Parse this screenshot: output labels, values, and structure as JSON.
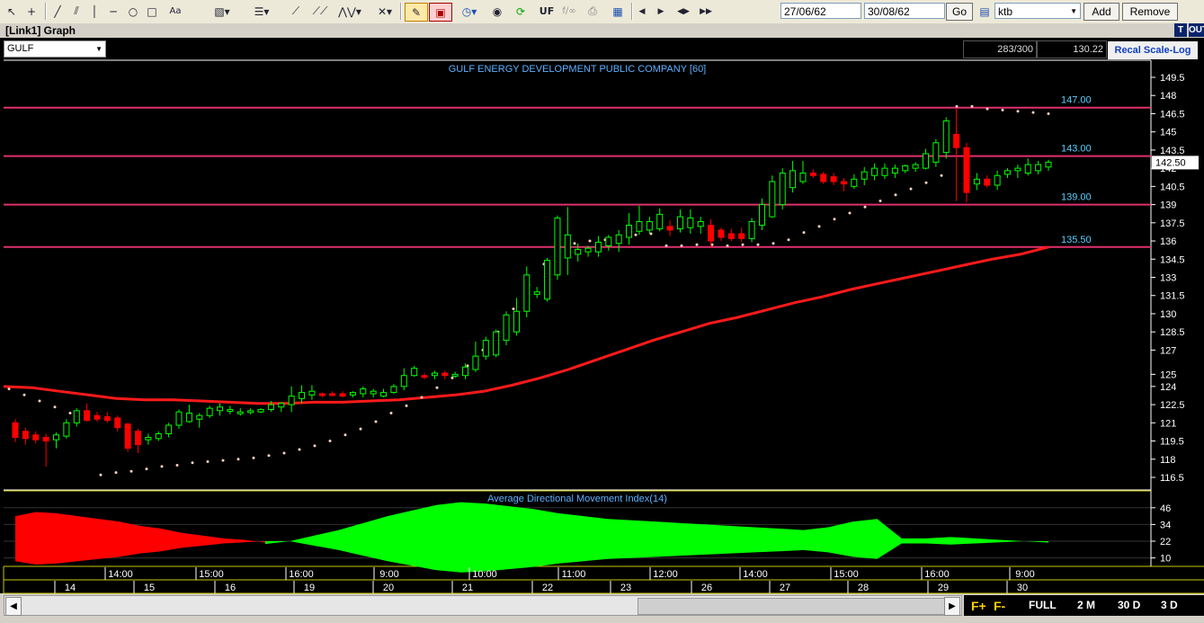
{
  "toolbar": {
    "icons": [
      "pointer-icon",
      "crosshair-icon",
      "line-icon",
      "parallel-lines-icon",
      "vertical-line-icon",
      "horizontal-line-icon",
      "circle-icon",
      "rectangle-icon",
      "text-icon",
      "fibonacci-icon",
      "horizontal-lines-icon",
      "channel-icon",
      "zigzag-icon",
      "delete-icon",
      "pencil-icon",
      "eraser-icon",
      "clock-icon",
      "palette-icon",
      "refresh-icon",
      "uf-icon",
      "fo-icon",
      "print-icon",
      "chart-icon",
      "left-icon",
      "right-icon",
      "expand-icon",
      "fast-forward-icon"
    ],
    "uf_label": "UF",
    "fo_label": "f∕∞",
    "date_from": "27/06/62",
    "date_to": "30/08/62",
    "go_label": "Go",
    "symbol_input": "ktb",
    "add_label": "Add",
    "remove_label": "Remove"
  },
  "window": {
    "title": "[Link1] Graph",
    "t_label": "T",
    "out_label": "OUT"
  },
  "symbol_select": "GULF",
  "info": {
    "count": "283/300",
    "last": "130.22",
    "recal": "Recal Scale-Log"
  },
  "colors": {
    "up": "#00ff00",
    "down": "#ff0000",
    "line": "#ff1a1a",
    "hline": "#e0306e",
    "text": "#5ab0ff",
    "axis": "#ffffff"
  },
  "chart_data": {
    "type": "candlestick",
    "title": "GULF ENERGY DEVELOPMENT PUBLIC COMPANY [60]",
    "price_ticks": [
      "116.5",
      "118",
      "119.5",
      "121",
      "122.5",
      "124",
      "125",
      "127",
      "128.5",
      "130",
      "131.5",
      "133",
      "134.5",
      "136",
      "137.5",
      "139",
      "140.5",
      "142",
      "143.5",
      "145",
      "146.5",
      "148",
      "149.5"
    ],
    "last_price": "142.50",
    "hlines": [
      {
        "value": 147.0,
        "label": "147.00"
      },
      {
        "value": 143.0,
        "label": "143.00"
      },
      {
        "value": 139.0,
        "label": "139.00"
      },
      {
        "value": 135.5,
        "label": "135.50"
      }
    ],
    "candles": [
      {
        "o": 121,
        "h": 121.3,
        "l": 119.4,
        "c": 119.8
      },
      {
        "o": 120.3,
        "h": 120.6,
        "l": 119.2,
        "c": 119.7
      },
      {
        "o": 120.0,
        "h": 120.3,
        "l": 119.3,
        "c": 119.6
      },
      {
        "o": 119.8,
        "h": 120.1,
        "l": 117.4,
        "c": 119.5
      },
      {
        "o": 119.6,
        "h": 120.2,
        "l": 118.9,
        "c": 120.0
      },
      {
        "o": 119.9,
        "h": 121.3,
        "l": 119.7,
        "c": 121.0
      },
      {
        "o": 121.0,
        "h": 122.2,
        "l": 120.7,
        "c": 122.0
      },
      {
        "o": 122.0,
        "h": 122.6,
        "l": 121.1,
        "c": 121.2
      },
      {
        "o": 121.6,
        "h": 121.9,
        "l": 121.1,
        "c": 121.3
      },
      {
        "o": 121.5,
        "h": 121.9,
        "l": 121.0,
        "c": 121.2
      },
      {
        "o": 121.4,
        "h": 121.6,
        "l": 120.3,
        "c": 120.6
      },
      {
        "o": 120.9,
        "h": 121.0,
        "l": 118.6,
        "c": 118.9
      },
      {
        "o": 120.3,
        "h": 120.5,
        "l": 118.5,
        "c": 119.2
      },
      {
        "o": 119.6,
        "h": 120.1,
        "l": 119.2,
        "c": 119.8
      },
      {
        "o": 119.7,
        "h": 120.3,
        "l": 119.5,
        "c": 120.1
      },
      {
        "o": 120.1,
        "h": 121.0,
        "l": 119.8,
        "c": 120.8
      },
      {
        "o": 120.8,
        "h": 122.1,
        "l": 120.5,
        "c": 121.9
      },
      {
        "o": 121.1,
        "h": 122.5,
        "l": 121.0,
        "c": 121.8
      },
      {
        "o": 121.3,
        "h": 121.8,
        "l": 120.6,
        "c": 121.6
      },
      {
        "o": 121.6,
        "h": 122.4,
        "l": 121.4,
        "c": 122.2
      },
      {
        "o": 122.0,
        "h": 122.6,
        "l": 121.6,
        "c": 122.3
      },
      {
        "o": 122.0,
        "h": 122.4,
        "l": 121.7,
        "c": 122.1
      },
      {
        "o": 121.8,
        "h": 122.2,
        "l": 121.6,
        "c": 121.9
      },
      {
        "o": 121.9,
        "h": 122.2,
        "l": 121.7,
        "c": 122.0
      },
      {
        "o": 121.9,
        "h": 122.2,
        "l": 121.8,
        "c": 122.1
      },
      {
        "o": 122.1,
        "h": 122.8,
        "l": 121.9,
        "c": 122.5
      },
      {
        "o": 122.3,
        "h": 122.7,
        "l": 121.9,
        "c": 122.6
      },
      {
        "o": 122.5,
        "h": 124.0,
        "l": 121.9,
        "c": 123.2
      },
      {
        "o": 123.0,
        "h": 124.1,
        "l": 122.6,
        "c": 123.5
      },
      {
        "o": 123.3,
        "h": 124.1,
        "l": 122.9,
        "c": 123.6
      },
      {
        "o": 123.4,
        "h": 123.5,
        "l": 123.1,
        "c": 123.3
      },
      {
        "o": 123.4,
        "h": 123.6,
        "l": 123.2,
        "c": 123.3
      },
      {
        "o": 123.4,
        "h": 123.6,
        "l": 123.1,
        "c": 123.2
      },
      {
        "o": 123.3,
        "h": 123.6,
        "l": 123.1,
        "c": 123.5
      },
      {
        "o": 123.4,
        "h": 124.0,
        "l": 123.1,
        "c": 123.8
      },
      {
        "o": 123.4,
        "h": 123.8,
        "l": 123.1,
        "c": 123.6
      },
      {
        "o": 123.2,
        "h": 123.8,
        "l": 123.1,
        "c": 123.5
      },
      {
        "o": 123.5,
        "h": 124.2,
        "l": 123.4,
        "c": 124.0
      },
      {
        "o": 124.0,
        "h": 125.5,
        "l": 123.7,
        "c": 124.9
      },
      {
        "o": 124.9,
        "h": 125.7,
        "l": 124.8,
        "c": 125.5
      },
      {
        "o": 124.9,
        "h": 125.1,
        "l": 124.6,
        "c": 124.8
      },
      {
        "o": 124.9,
        "h": 125.3,
        "l": 124.6,
        "c": 125.1
      },
      {
        "o": 125.1,
        "h": 125.3,
        "l": 124.6,
        "c": 124.9
      },
      {
        "o": 124.9,
        "h": 125.2,
        "l": 124.7,
        "c": 125.0
      },
      {
        "o": 124.9,
        "h": 125.9,
        "l": 124.6,
        "c": 125.6
      },
      {
        "o": 125.4,
        "h": 127.7,
        "l": 125.2,
        "c": 126.5
      },
      {
        "o": 126.5,
        "h": 128.1,
        "l": 126.2,
        "c": 127.8
      },
      {
        "o": 126.6,
        "h": 128.7,
        "l": 126.4,
        "c": 128.5
      },
      {
        "o": 127.8,
        "h": 130.2,
        "l": 127.4,
        "c": 129.9
      },
      {
        "o": 128.5,
        "h": 131.3,
        "l": 128.2,
        "c": 130.2
      },
      {
        "o": 130.2,
        "h": 133.9,
        "l": 129.7,
        "c": 133.2
      },
      {
        "o": 131.6,
        "h": 132.2,
        "l": 131.3,
        "c": 131.8
      },
      {
        "o": 131.2,
        "h": 134.6,
        "l": 131.0,
        "c": 134.4
      },
      {
        "o": 133.2,
        "h": 138.1,
        "l": 132.8,
        "c": 137.9
      },
      {
        "o": 134.6,
        "h": 138.8,
        "l": 133.2,
        "c": 136.5
      },
      {
        "o": 134.9,
        "h": 135.8,
        "l": 134.3,
        "c": 135.3
      },
      {
        "o": 135.1,
        "h": 135.6,
        "l": 134.7,
        "c": 135.4
      },
      {
        "o": 135.1,
        "h": 136.4,
        "l": 134.7,
        "c": 135.9
      },
      {
        "o": 135.6,
        "h": 136.5,
        "l": 135.2,
        "c": 136.3
      },
      {
        "o": 135.8,
        "h": 136.9,
        "l": 135.1,
        "c": 136.5
      },
      {
        "o": 136.3,
        "h": 138.3,
        "l": 135.7,
        "c": 137.3
      },
      {
        "o": 136.8,
        "h": 138.9,
        "l": 136.5,
        "c": 137.6
      },
      {
        "o": 136.9,
        "h": 138.0,
        "l": 136.6,
        "c": 137.6
      },
      {
        "o": 137.0,
        "h": 138.7,
        "l": 136.8,
        "c": 138.2
      },
      {
        "o": 137.2,
        "h": 137.7,
        "l": 136.4,
        "c": 136.9
      },
      {
        "o": 137.0,
        "h": 138.6,
        "l": 136.7,
        "c": 138.0
      },
      {
        "o": 137.1,
        "h": 138.6,
        "l": 136.6,
        "c": 137.9
      },
      {
        "o": 137.2,
        "h": 138.0,
        "l": 136.6,
        "c": 137.6
      },
      {
        "o": 137.3,
        "h": 137.8,
        "l": 135.5,
        "c": 136.0
      },
      {
        "o": 136.9,
        "h": 137.1,
        "l": 136.0,
        "c": 136.3
      },
      {
        "o": 136.6,
        "h": 137.0,
        "l": 136.0,
        "c": 136.2
      },
      {
        "o": 136.6,
        "h": 137.1,
        "l": 135.9,
        "c": 136.2
      },
      {
        "o": 136.2,
        "h": 137.9,
        "l": 135.9,
        "c": 137.6
      },
      {
        "o": 137.3,
        "h": 139.5,
        "l": 136.9,
        "c": 139.0
      },
      {
        "o": 138.0,
        "h": 141.4,
        "l": 137.9,
        "c": 140.9
      },
      {
        "o": 139.0,
        "h": 142.0,
        "l": 138.6,
        "c": 141.6
      },
      {
        "o": 140.4,
        "h": 142.6,
        "l": 140.0,
        "c": 141.8
      },
      {
        "o": 140.9,
        "h": 142.6,
        "l": 140.7,
        "c": 141.6
      },
      {
        "o": 141.6,
        "h": 141.9,
        "l": 141.2,
        "c": 141.4
      },
      {
        "o": 141.5,
        "h": 141.7,
        "l": 140.7,
        "c": 140.9
      },
      {
        "o": 141.3,
        "h": 141.6,
        "l": 140.6,
        "c": 140.9
      },
      {
        "o": 140.9,
        "h": 141.2,
        "l": 140.1,
        "c": 140.7
      },
      {
        "o": 140.5,
        "h": 141.5,
        "l": 140.3,
        "c": 141.1
      },
      {
        "o": 141.1,
        "h": 142.1,
        "l": 140.6,
        "c": 141.7
      },
      {
        "o": 141.4,
        "h": 142.4,
        "l": 141.0,
        "c": 142.0
      },
      {
        "o": 141.4,
        "h": 142.4,
        "l": 141.1,
        "c": 142.0
      },
      {
        "o": 141.6,
        "h": 142.3,
        "l": 141.2,
        "c": 142.0
      },
      {
        "o": 141.8,
        "h": 142.3,
        "l": 141.6,
        "c": 142.2
      },
      {
        "o": 142.0,
        "h": 142.5,
        "l": 141.7,
        "c": 142.3
      },
      {
        "o": 142.0,
        "h": 143.6,
        "l": 141.9,
        "c": 143.2
      },
      {
        "o": 142.5,
        "h": 144.4,
        "l": 142.1,
        "c": 144.1
      },
      {
        "o": 143.3,
        "h": 146.2,
        "l": 142.8,
        "c": 145.9
      },
      {
        "o": 144.8,
        "h": 147.0,
        "l": 139.3,
        "c": 143.7
      },
      {
        "o": 143.7,
        "h": 144.1,
        "l": 139.2,
        "c": 140.0
      },
      {
        "o": 140.7,
        "h": 141.6,
        "l": 140.2,
        "c": 141.1
      },
      {
        "o": 141.1,
        "h": 141.4,
        "l": 140.4,
        "c": 140.6
      },
      {
        "o": 140.6,
        "h": 141.8,
        "l": 140.2,
        "c": 141.4
      },
      {
        "o": 141.5,
        "h": 142.0,
        "l": 141.2,
        "c": 141.8
      },
      {
        "o": 141.8,
        "h": 142.3,
        "l": 141.2,
        "c": 142.0
      },
      {
        "o": 141.6,
        "h": 142.8,
        "l": 141.4,
        "c": 142.3
      },
      {
        "o": 141.8,
        "h": 142.6,
        "l": 141.5,
        "c": 142.3
      },
      {
        "o": 142.1,
        "h": 142.7,
        "l": 141.8,
        "c": 142.5
      }
    ],
    "ma": [
      124.0,
      123.9,
      123.6,
      123.3,
      123.0,
      122.9,
      122.9,
      122.8,
      122.7,
      122.6,
      122.6,
      122.7,
      122.7,
      122.8,
      122.9,
      123.1,
      123.3,
      123.6,
      124.1,
      124.7,
      125.4,
      126.2,
      127.0,
      127.8,
      128.5,
      129.2,
      129.7,
      130.3,
      130.9,
      131.4,
      132.0,
      132.5,
      133.0,
      133.5,
      134.0,
      134.5,
      134.9,
      135.5
    ],
    "sar": [
      123.8,
      123.3,
      122.8,
      122.3,
      121.8,
      121.3,
      116.7,
      116.9,
      117.0,
      117.2,
      117.4,
      117.5,
      117.7,
      117.8,
      117.9,
      118.0,
      118.1,
      118.3,
      118.5,
      118.8,
      119.1,
      119.5,
      120.0,
      120.5,
      121.1,
      121.8,
      122.4,
      123.1,
      123.9,
      124.7,
      125.7,
      127.0,
      128.5,
      130.4,
      132.4,
      134.1,
      135.1,
      135.8,
      136.0,
      136.1,
      136.3,
      136.5,
      136.6,
      135.6,
      135.6,
      135.7,
      135.7,
      135.6,
      135.7,
      135.7,
      135.8,
      136.1,
      136.7,
      137.2,
      137.8,
      138.3,
      138.8,
      139.3,
      139.8,
      140.3,
      140.8,
      141.4,
      147.1,
      147.1,
      146.9,
      146.8,
      146.7,
      146.6,
      146.5
    ],
    "adx_title": "Average Directional Movement Index(14)",
    "adx_ticks": [
      "46",
      "34",
      "22",
      "10"
    ],
    "adx_red": [
      40,
      43,
      42,
      40,
      38,
      36,
      33,
      31,
      28,
      26,
      24,
      23,
      21
    ],
    "adx_green": [
      20,
      22,
      26,
      30,
      35,
      40,
      44,
      48,
      50,
      49,
      47,
      45,
      42,
      40,
      38,
      37,
      36,
      35,
      34,
      33,
      32,
      31,
      30,
      32,
      36,
      38,
      24,
      24,
      25,
      24,
      23,
      22,
      21
    ],
    "time_labels": [
      "14:00",
      "15:00",
      "16:00",
      "9:00",
      "10:00",
      "11:00",
      "12:00",
      "14:00",
      "15:00",
      "16:00",
      "9:00"
    ],
    "day_labels": [
      "14",
      "15",
      "16",
      "19",
      "20",
      "21",
      "22",
      "23",
      "26",
      "27",
      "28",
      "29",
      "30"
    ]
  },
  "zoom": {
    "f_plus": "F+",
    "f_minus": "F-",
    "full": "FULL",
    "m2": "2 M",
    "d30": "30 D",
    "d3": "3 D"
  }
}
